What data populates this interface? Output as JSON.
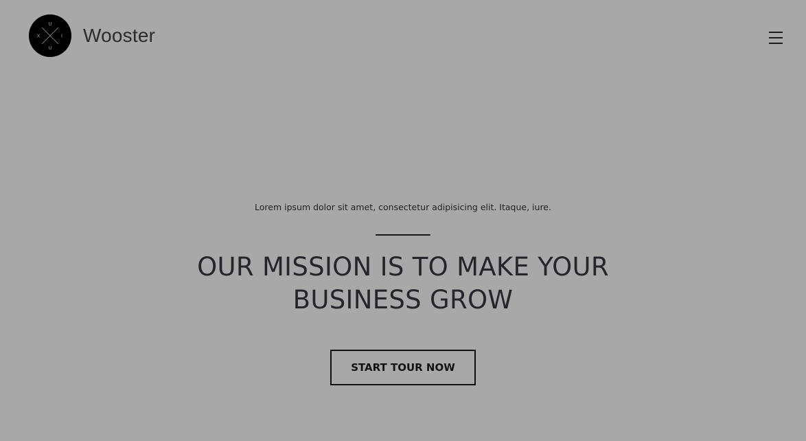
{
  "header": {
    "brand_name": "Wooster",
    "logo_letters": [
      "U",
      "I",
      "U",
      "X"
    ]
  },
  "hero": {
    "tagline": "Lorem ipsum dolor sit amet, consectetur adipisicing elit. Itaque, iure.",
    "headline": "OUR MISSION IS TO MAKE YOUR BUSINESS GROW",
    "cta_label": "START TOUR NOW"
  },
  "colors": {
    "background": "#a9a8a9",
    "text": "#222326",
    "logo": "#000000"
  },
  "icons": [
    "logo-mark",
    "hamburger-menu-icon"
  ]
}
